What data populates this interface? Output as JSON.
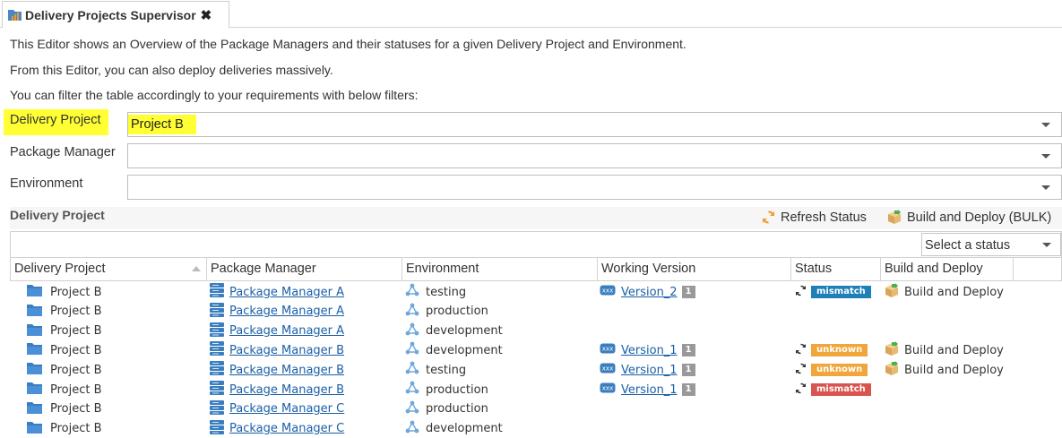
{
  "tab": {
    "title": "Delivery Projects Supervisor",
    "close": "✖"
  },
  "description": {
    "line1": "This Editor shows an Overview of the Package Managers and their statuses for a given Delivery Project and Environment.",
    "line2": "From this Editor, you can also deploy deliveries massively.",
    "line3": "You can filter the table accordingly to your requirements with below filters:"
  },
  "filters": {
    "delivery_project": {
      "label": "Delivery Project",
      "value": "Project B"
    },
    "package_manager": {
      "label": "Package Manager",
      "value": ""
    },
    "environment": {
      "label": "Environment",
      "value": ""
    }
  },
  "section": {
    "title": "Delivery Project",
    "refresh_label": "Refresh Status",
    "bulk_label": "Build and Deploy (BULK)"
  },
  "status_filter": {
    "placeholder": "Select a status"
  },
  "table": {
    "headers": {
      "project": "Delivery Project",
      "package_manager": "Package Manager",
      "environment": "Environment",
      "version": "Working Version",
      "status": "Status",
      "build": "Build and Deploy"
    },
    "rows": [
      {
        "project": "Project B",
        "package_manager": "Package Manager A",
        "environment": "testing",
        "version": "Version_2",
        "count": "1",
        "status": "mismatch",
        "status_color": "#1f7fb8",
        "build": "Build and Deploy"
      },
      {
        "project": "Project B",
        "package_manager": "Package Manager A",
        "environment": "production",
        "version": "",
        "count": "",
        "status": "",
        "status_color": "",
        "build": ""
      },
      {
        "project": "Project B",
        "package_manager": "Package Manager A",
        "environment": "development",
        "version": "",
        "count": "",
        "status": "",
        "status_color": "",
        "build": ""
      },
      {
        "project": "Project B",
        "package_manager": "Package Manager B",
        "environment": "development",
        "version": "Version_1",
        "count": "1",
        "status": "unknown",
        "status_color": "#f0a63a",
        "build": "Build and Deploy"
      },
      {
        "project": "Project B",
        "package_manager": "Package Manager B",
        "environment": "testing",
        "version": "Version_1",
        "count": "1",
        "status": "unknown",
        "status_color": "#f0a63a",
        "build": "Build and Deploy"
      },
      {
        "project": "Project B",
        "package_manager": "Package Manager B",
        "environment": "production",
        "version": "Version_1",
        "count": "1",
        "status": "mismatch",
        "status_color": "#d9534f",
        "build": ""
      },
      {
        "project": "Project B",
        "package_manager": "Package Manager C",
        "environment": "production",
        "version": "",
        "count": "",
        "status": "",
        "status_color": "",
        "build": ""
      },
      {
        "project": "Project B",
        "package_manager": "Package Manager C",
        "environment": "development",
        "version": "",
        "count": "",
        "status": "",
        "status_color": "",
        "build": ""
      }
    ]
  },
  "colors": {
    "highlight": "#ffff33",
    "link": "#1a5fa8",
    "accent": "#1f7fb8"
  }
}
